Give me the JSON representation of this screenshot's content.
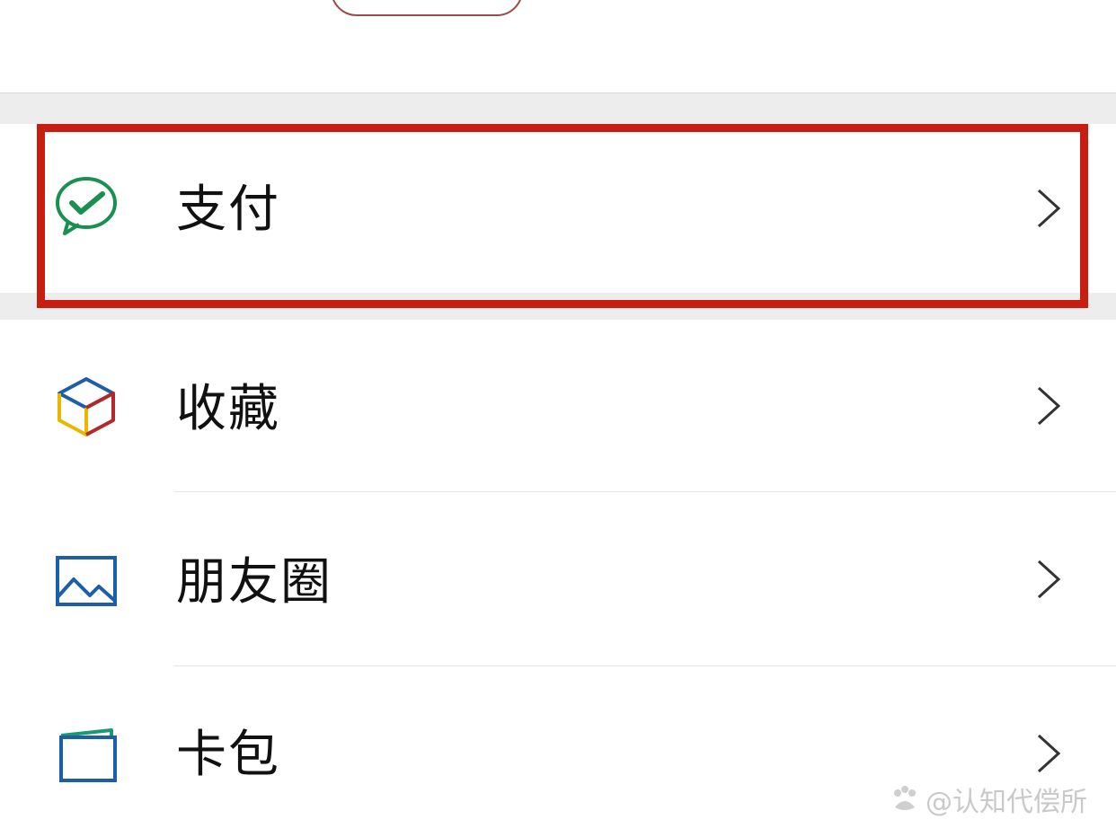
{
  "menu": {
    "items": [
      {
        "label": "支付",
        "icon": "wechat-pay-icon"
      },
      {
        "label": "收藏",
        "icon": "favorites-cube-icon"
      },
      {
        "label": "朋友圈",
        "icon": "moments-picture-icon"
      },
      {
        "label": "卡包",
        "icon": "card-wallet-icon"
      }
    ],
    "highlighted_item": "支付"
  },
  "watermark": {
    "text": "@认知代偿所"
  },
  "colors": {
    "highlight": "#c81e12",
    "pay_green": "#1a8f52",
    "moments_blue": "#1d5ea8",
    "chevron": "#333333"
  }
}
